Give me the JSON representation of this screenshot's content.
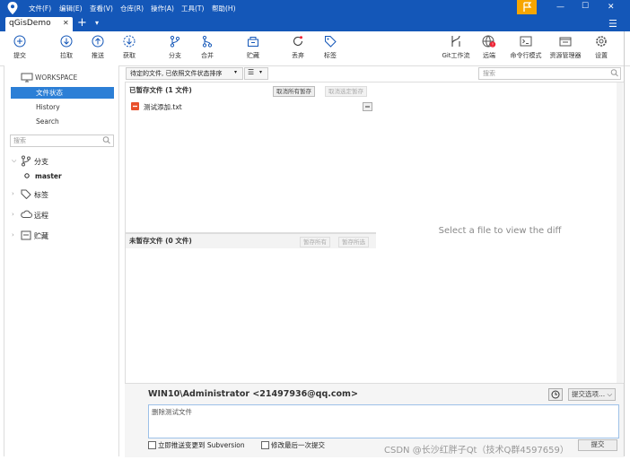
{
  "window": {
    "menu": [
      "文件(F)",
      "编辑(E)",
      "查看(V)",
      "仓库(R)",
      "操作(A)",
      "工具(T)",
      "帮助(H)"
    ],
    "tab_title": "qGisDemo",
    "controls": {
      "minimize": "—",
      "maximize": "☐",
      "close": "✕"
    }
  },
  "toolbar": {
    "commit": "提交",
    "pull": "拉取",
    "push": "推送",
    "fetch": "获取",
    "branch": "分支",
    "merge": "合并",
    "stash": "贮藏",
    "discard": "丢弃",
    "tag": "标签",
    "gitflow": "Git工作流",
    "remote": "远端",
    "terminal": "命令行模式",
    "explorer": "资源管理器",
    "settings": "设置"
  },
  "sidebar": {
    "workspace": "WORKSPACE",
    "file_status": "文件状态",
    "history": "History",
    "search": "Search",
    "search_placeholder": "搜索",
    "branches": "分支",
    "current_branch": "master",
    "tags": "标签",
    "remotes": "远程",
    "stashes": "贮藏"
  },
  "filter": {
    "pending_label": "待定的文件, 已依照文件状态排序",
    "menu_glyph": "☰",
    "search_placeholder": "搜索"
  },
  "staged": {
    "header": "已暂存文件  (1 文件)",
    "unstage_all": "取消所有暂存",
    "unstage_selected": "取消选定暂存",
    "files": [
      "测试添加.txt"
    ]
  },
  "unstaged": {
    "header": "未暂存文件  (0 文件)",
    "stage_all": "暂存所有",
    "stage_selected": "暂存所选"
  },
  "diff": {
    "placeholder": "Select a file to view the diff"
  },
  "commit": {
    "author": "WIN10\\Administrator <21497936@qq.com>",
    "message": "删除测试文件",
    "options_label": "提交选项...",
    "push_checkbox": "立即推送变更到 Subversion",
    "amend_checkbox": "修改最后一次提交",
    "commit_button": "提交"
  },
  "watermark": "CSDN @长沙红胖子Qt（技术Q群4597659）"
}
